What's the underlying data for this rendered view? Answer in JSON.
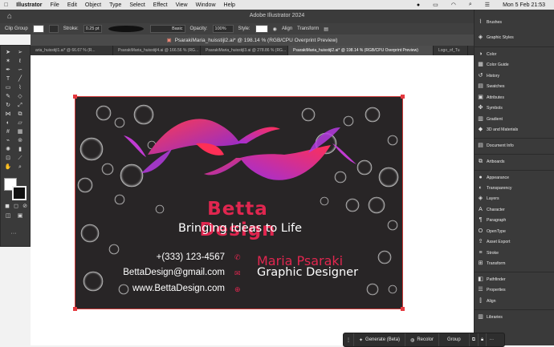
{
  "menubar": {
    "apple": "",
    "app": "Illustrator",
    "items": [
      "File",
      "Edit",
      "Object",
      "Type",
      "Select",
      "Effect",
      "View",
      "Window",
      "Help"
    ],
    "datetime": "Mon 5 Feb  21:53"
  },
  "window": {
    "title": "Adobe Illustrator 2024"
  },
  "control": {
    "selection": "Clip Group",
    "stroke_label": "Stroke:",
    "stroke_value": "0.25 pt",
    "profile": "Basic",
    "opacity_label": "Opacity:",
    "opacity_value": "100%",
    "style_label": "Style:",
    "align": "Align",
    "transform": "Transform"
  },
  "document": {
    "active_title": "PsarakiMaria_huisstijl2.ai* @ 198.14 % (RGB/CPU Overprint Preview)",
    "tabs": [
      "aria_huisstijl1.ai* @ 66.67 % (R...",
      "PsarakiMaria_huisstijl4.ai @ 166.56 % (RG...",
      "PsarakiMaria_huisstijl3.ai @ 278.86 % (RG...",
      "PsarakiMaria_huisstijl2.ai* @ 198.14 % (RGB/CPU Overprint Preview)",
      "Logo_of_Tu"
    ]
  },
  "card": {
    "brand": "Betta Design",
    "tagline": "Bringing Ideas to Life",
    "phone": "+(333) 123-4567",
    "email": "BettaDesign@gmail.com",
    "web": "www.BettaDesign.com",
    "name": "Maria Psaraki",
    "role": "Graphic Designer"
  },
  "panels": [
    {
      "label": "Brushes",
      "icon": "brush-icon"
    },
    {
      "label": "Graphic Styles",
      "icon": "graphic-styles-icon"
    },
    {
      "label": "Color",
      "icon": "color-icon"
    },
    {
      "label": "Color Guide",
      "icon": "color-guide-icon"
    },
    {
      "label": "History",
      "icon": "history-icon"
    },
    {
      "label": "Swatches",
      "icon": "swatches-icon"
    },
    {
      "label": "Attributes",
      "icon": "attributes-icon"
    },
    {
      "label": "Symbols",
      "icon": "symbols-icon"
    },
    {
      "label": "Gradient",
      "icon": "gradient-icon"
    },
    {
      "label": "3D and Materials",
      "icon": "3d-icon"
    },
    {
      "label": "Document Info",
      "icon": "document-info-icon"
    },
    {
      "label": "Artboards",
      "icon": "artboards-icon"
    },
    {
      "label": "Appearance",
      "icon": "appearance-icon"
    },
    {
      "label": "Transparency",
      "icon": "transparency-icon"
    },
    {
      "label": "Layers",
      "icon": "layers-icon"
    },
    {
      "label": "Character",
      "icon": "character-icon"
    },
    {
      "label": "Paragraph",
      "icon": "paragraph-icon"
    },
    {
      "label": "OpenType",
      "icon": "opentype-icon"
    },
    {
      "label": "Asset Export",
      "icon": "asset-export-icon"
    },
    {
      "label": "Stroke",
      "icon": "stroke-icon"
    },
    {
      "label": "Transform",
      "icon": "transform-icon"
    },
    {
      "label": "Pathfinder",
      "icon": "pathfinder-icon"
    },
    {
      "label": "Properties",
      "icon": "properties-icon"
    },
    {
      "label": "Align",
      "icon": "align-icon"
    },
    {
      "label": "Libraries",
      "icon": "libraries-icon"
    }
  ],
  "context_bar": {
    "generate": "Generate (Beta)",
    "recolor": "Recolor",
    "group": "Group"
  },
  "colors": {
    "accent": "#e5393f",
    "artboard": "#282526",
    "pink": "#e0264f"
  }
}
